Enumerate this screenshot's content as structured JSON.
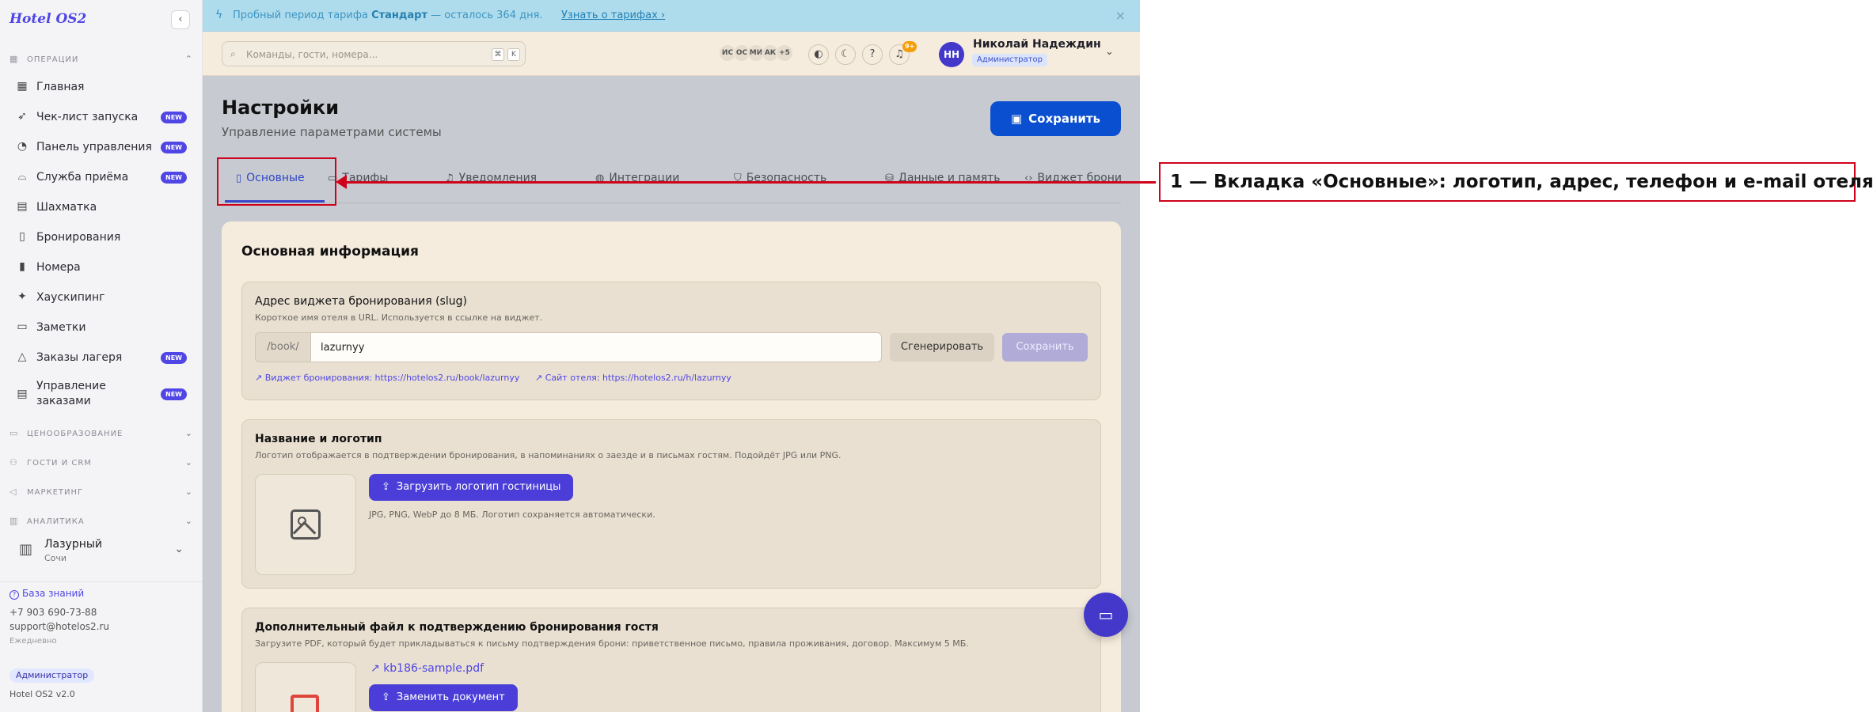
{
  "app": {
    "brand": "Hotel OS2",
    "collapse_icon": "chevron-left-icon"
  },
  "sidebar": {
    "sections": [
      {
        "label": "ОПЕРАЦИИ",
        "icon": "grid-icon",
        "expanded": true
      },
      {
        "label": "ЦЕНООБРАЗОВАНИЕ",
        "icon": "wallet-icon",
        "expanded": false
      },
      {
        "label": "ГОСТИ И CRM",
        "icon": "users-icon",
        "expanded": false
      },
      {
        "label": "МАРКЕТИНГ",
        "icon": "megaphone-icon",
        "expanded": false
      },
      {
        "label": "АНАЛИТИКА",
        "icon": "chart-icon",
        "expanded": false
      }
    ],
    "items": [
      {
        "label": "Главная",
        "icon": "dashboard-icon",
        "badge": ""
      },
      {
        "label": "Чек-лист запуска",
        "icon": "rocket-icon",
        "badge": "NEW"
      },
      {
        "label": "Панель управления",
        "icon": "gauge-icon",
        "badge": "NEW"
      },
      {
        "label": "Служба приёма",
        "icon": "bell-desk-icon",
        "badge": "NEW"
      },
      {
        "label": "Шахматка",
        "icon": "table-grid-icon",
        "badge": ""
      },
      {
        "label": "Бронирования",
        "icon": "clipboard-icon",
        "badge": ""
      },
      {
        "label": "Номера",
        "icon": "door-icon",
        "badge": ""
      },
      {
        "label": "Хаускипинг",
        "icon": "sparkles-icon",
        "badge": ""
      },
      {
        "label": "Заметки",
        "icon": "note-icon",
        "badge": ""
      },
      {
        "label": "Заказы лагеря",
        "icon": "tent-icon",
        "badge": "NEW"
      },
      {
        "label": "Управление заказами",
        "icon": "receipt-icon",
        "badge": "NEW"
      }
    ],
    "hotel": {
      "name": "Лазурный",
      "city": "Сочи"
    },
    "footer": {
      "knowledge_base": "База знаний",
      "phone": "+7 903 690-73-88",
      "email": "support@hotelos2.ru",
      "schedule": "Ежедневно",
      "role": "Администратор",
      "version": "Hotel OS2 v2.0"
    }
  },
  "banner": {
    "text_before": "Пробный период тарифа",
    "plan": "Стандарт",
    "text_after": "— осталось 364 дня.",
    "link": "Узнать о тарифах",
    "link_arrow": "›",
    "close": "×"
  },
  "topbar": {
    "search_placeholder": "Команды, гости, номера...",
    "kbd": [
      "⌘",
      "K"
    ],
    "online_users": [
      "ИС",
      "ОС",
      "МИ",
      "АК"
    ],
    "online_more": "+5",
    "notif_count": "9+",
    "user": {
      "initials": "НН",
      "name": "Николай Надеждин",
      "role": "Администратор"
    }
  },
  "page": {
    "title": "Настройки",
    "subtitle": "Управление параметрами системы",
    "save_label": "Сохранить"
  },
  "tabs": [
    {
      "label": "Основные",
      "icon": "building-icon",
      "active": true
    },
    {
      "label": "Тарифы",
      "icon": "card-icon",
      "active": false
    },
    {
      "label": "Уведомления",
      "icon": "bell-icon",
      "active": false
    },
    {
      "label": "Интеграции",
      "icon": "globe-icon",
      "active": false
    },
    {
      "label": "Безопасность",
      "icon": "shield-icon",
      "active": false
    },
    {
      "label": "Данные и память",
      "icon": "database-icon",
      "active": false
    },
    {
      "label": "Виджет бронирова",
      "icon": "code-icon",
      "active": false
    }
  ],
  "general": {
    "title": "Основная информация",
    "slug": {
      "heading": "Адрес виджета бронирования (slug)",
      "description": "Короткое имя отеля в URL. Используется в ссылке на виджет.",
      "prefix": "/book/",
      "value": "lazurnyy",
      "generate_label": "Сгенерировать",
      "save_label": "Сохранить",
      "widget_link": "Виджет бронирования: https://hotelos2.ru/book/lazurnyy",
      "site_link": "Сайт отеля: https://hotelos2.ru/h/lazurnyy"
    },
    "logo": {
      "heading": "Название и логотип",
      "description": "Логотип отображается в подтверждении бронирования, в напоминаниях о заезде и в письмах гостям. Подойдёт JPG или PNG.",
      "upload_label": "Загрузить логотип гостиницы",
      "hint": "JPG, PNG, WebP до 8 МБ. Логотип сохраняется автоматически."
    },
    "attachment": {
      "heading": "Дополнительный файл к подтверждению бронирования гостя",
      "description": "Загрузите PDF, который будет прикладываться к письму подтверждения брони: приветственное письмо, правила проживания, договор. Максимум 5 МБ.",
      "file_name": "kb186-sample.pdf",
      "replace_label": "Заменить документ"
    }
  },
  "annotation": {
    "label": "1 — Вкладка «Основные»: логотип, адрес, телефон и e-mail отеля"
  },
  "colors": {
    "accent": "#4f46e5",
    "primary_button": "#0a4fcf",
    "annotation": "#d0021b"
  }
}
